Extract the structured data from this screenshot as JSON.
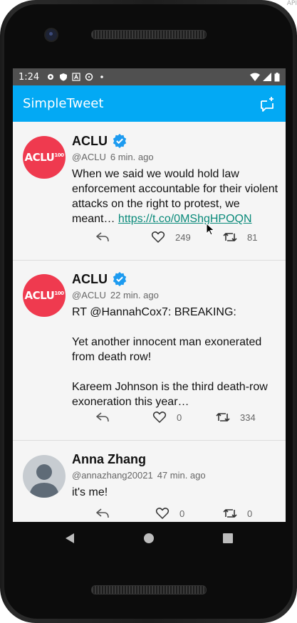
{
  "device": {
    "api_text": "API"
  },
  "status": {
    "time": "1:24"
  },
  "app": {
    "title": "SimpleTweet",
    "compose_icon": "compose-icon"
  },
  "tweets": [
    {
      "name": "ACLU",
      "verified": true,
      "handle": "@ACLU",
      "time": "6 min. ago",
      "body": "When we said we would hold law enforcement accountable for their violent attacks on the right to protest, we meant…",
      "link": "https://t.co/0MShgHPOQN",
      "likes": "249",
      "retweets": "81",
      "avatar_text": "ACLU",
      "avatar_sup": "100"
    },
    {
      "name": "ACLU",
      "verified": true,
      "handle": "@ACLU",
      "time": "22 min. ago",
      "body": "RT @HannahCox7: BREAKING:\n\nYet another innocent man exonerated from death row!\n\nKareem Johnson is the third death-row exoneration this year…",
      "likes": "0",
      "retweets": "334",
      "avatar_text": "ACLU",
      "avatar_sup": "100"
    },
    {
      "name": "Anna Zhang",
      "verified": false,
      "handle": "@annazhang20021",
      "time": "47 min. ago",
      "body": "it's me!",
      "likes": "0",
      "retweets": "0"
    }
  ],
  "colors": {
    "appbar": "#03a9f4",
    "aclu": "#ef3a4f",
    "verified": "#1d9bf0",
    "link": "#0a8a7a"
  }
}
